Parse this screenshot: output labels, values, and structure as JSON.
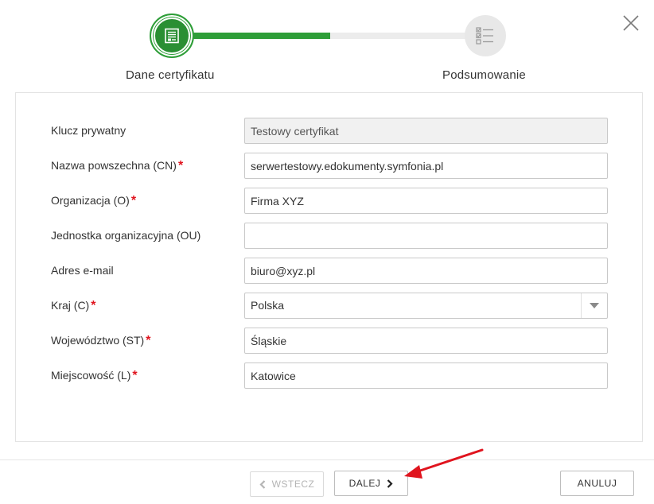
{
  "stepper": {
    "progress": 0.5,
    "steps": [
      {
        "label": "Dane certyfikatu",
        "state": "active",
        "icon": "certificate-document-icon"
      },
      {
        "label": "Podsumowanie",
        "state": "pending",
        "icon": "checklist-icon"
      }
    ]
  },
  "form": {
    "fields": [
      {
        "label": "Klucz prywatny",
        "required": false,
        "value": "Testowy certyfikat",
        "readonly": true
      },
      {
        "label": "Nazwa powszechna (CN)",
        "required": true,
        "value": "serwertestowy.edokumenty.symfonia.pl"
      },
      {
        "label": "Organizacja (O)",
        "required": true,
        "value": "Firma XYZ"
      },
      {
        "label": "Jednostka organizacyjna (OU)",
        "required": false,
        "value": ""
      },
      {
        "label": "Adres e-mail",
        "required": false,
        "value": "biuro@xyz.pl"
      },
      {
        "label": "Kraj (C)",
        "required": true,
        "value": "Polska",
        "type": "select"
      },
      {
        "label": "Województwo (ST)",
        "required": true,
        "value": "Śląskie"
      },
      {
        "label": "Miejscowość (L)",
        "required": true,
        "value": "Katowice"
      }
    ],
    "required_marker": "*"
  },
  "footer": {
    "back_label": "WSTECZ",
    "next_label": "DALEJ",
    "cancel_label": "ANULUJ"
  },
  "colors": {
    "accent": "#2e9e38",
    "required": "#e0141e",
    "annotation_arrow": "#e0141e"
  }
}
